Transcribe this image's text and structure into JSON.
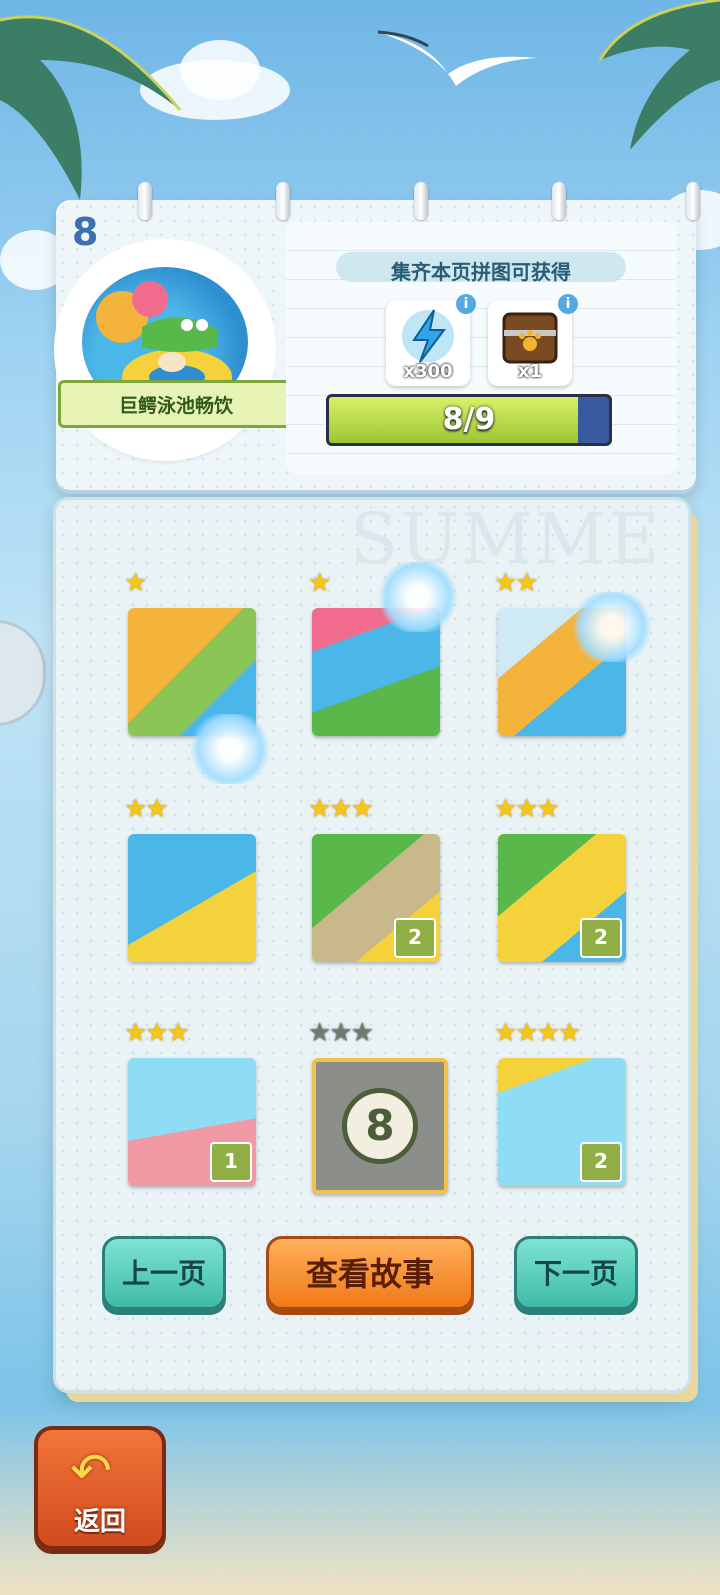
{
  "page_number": "8",
  "theme": {
    "accent_blue": "#3c6fb3",
    "progress_fill": "#b3dc4a",
    "button_teal": "#4cc7b3",
    "button_orange": "#f2882a",
    "back_button": "#e2592a"
  },
  "badge": {
    "title": "巨鳄泳池畅饮",
    "icon": "crocodile-pool-badge-icon"
  },
  "reward": {
    "title": "集齐本页拼图可获得",
    "items": [
      {
        "icon": "lightning-energy-icon",
        "qty": "x300",
        "info": "i"
      },
      {
        "icon": "paw-chest-icon",
        "qty": "x1",
        "info": "i"
      }
    ],
    "progress_text": "8/9",
    "progress_value": 0.89
  },
  "board": {
    "watermark": "SUMME",
    "pieces": [
      {
        "stars": "★",
        "stars_count": 1,
        "count": null,
        "locked": false
      },
      {
        "stars": "★",
        "stars_count": 1,
        "count": null,
        "locked": false
      },
      {
        "stars": "★★",
        "stars_count": 2,
        "count": null,
        "locked": false
      },
      {
        "stars": "★★",
        "stars_count": 2,
        "count": null,
        "locked": false
      },
      {
        "stars": "★★★",
        "stars_count": 3,
        "count": "2",
        "locked": false
      },
      {
        "stars": "★★★",
        "stars_count": 3,
        "count": "2",
        "locked": false
      },
      {
        "stars": "★★★",
        "stars_count": 3,
        "count": "1",
        "locked": false
      },
      {
        "stars": "★★★",
        "stars_count": 3,
        "count": null,
        "locked": true,
        "locked_number": "8"
      },
      {
        "stars": "★★★★",
        "stars_count": 4,
        "count": "2",
        "locked": false
      }
    ]
  },
  "buttons": {
    "prev": "上一页",
    "story": "查看故事",
    "next": "下一页",
    "back": "返回"
  }
}
